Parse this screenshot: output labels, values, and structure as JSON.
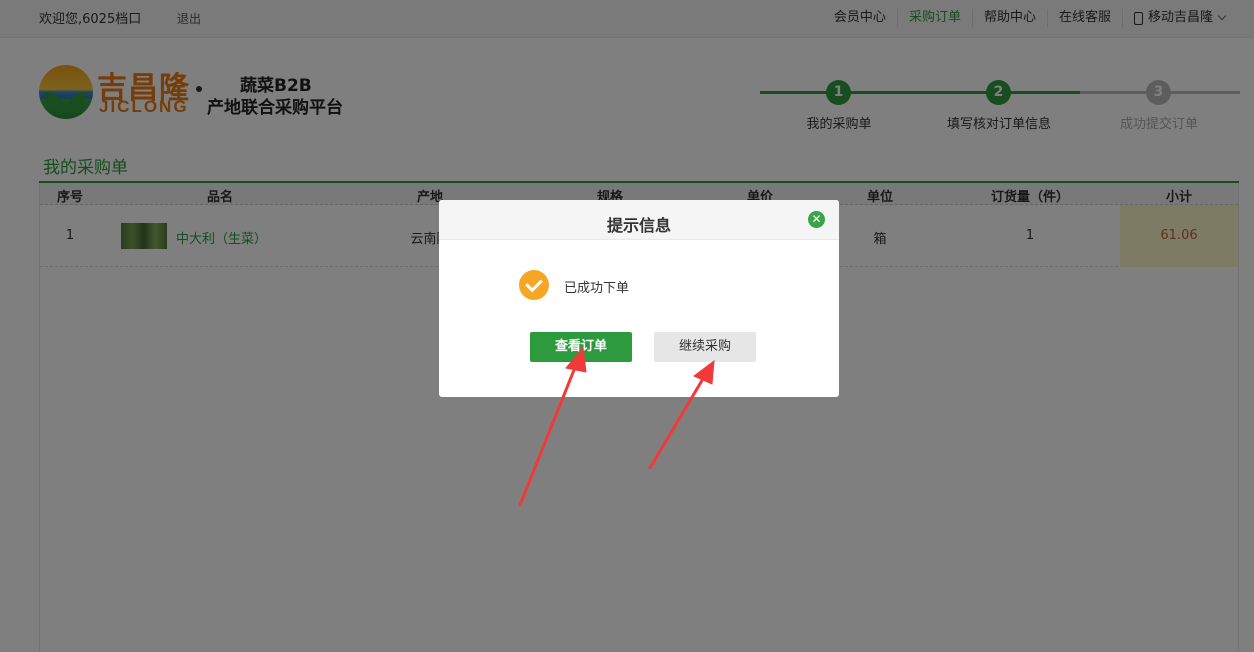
{
  "topbar": {
    "welcome": "欢迎您,6025档口",
    "logout": "退出",
    "nav": [
      {
        "label": "会员中心",
        "active": false
      },
      {
        "label": "采购订单",
        "active": true
      },
      {
        "label": "帮助中心",
        "active": false
      },
      {
        "label": "在线客服",
        "active": false
      }
    ],
    "mobile_label": "移动吉昌隆"
  },
  "header": {
    "logo_cn": "吉昌隆",
    "logo_en": "JICLONG",
    "slogan_line1": "蔬菜B2B",
    "slogan_line2": "产地联合采购平台"
  },
  "steps": [
    {
      "number": "1",
      "label": "我的采购单",
      "done": true
    },
    {
      "number": "2",
      "label": "填写核对订单信息",
      "done": true
    },
    {
      "number": "3",
      "label": "成功提交订单",
      "done": false
    }
  ],
  "section_title": "我的采购单",
  "table": {
    "headers": [
      "序号",
      "品名",
      "产地",
      "规格",
      "单价",
      "单位",
      "订货量（件）",
      "小计"
    ],
    "rows": [
      {
        "index": "1",
        "name": "中大利（生菜）",
        "origin": "云南陆",
        "unit": "箱",
        "qty": "1",
        "subtotal": "61.06"
      }
    ]
  },
  "modal": {
    "title": "提示信息",
    "message": "已成功下单",
    "primary_button": "查看订单",
    "secondary_button": "继续采购"
  },
  "colors": {
    "brand_green": "#2e9a3e",
    "brand_orange": "#ec7a12",
    "success_icon": "#f5a623",
    "annotation_arrow": "#f03a3a"
  }
}
